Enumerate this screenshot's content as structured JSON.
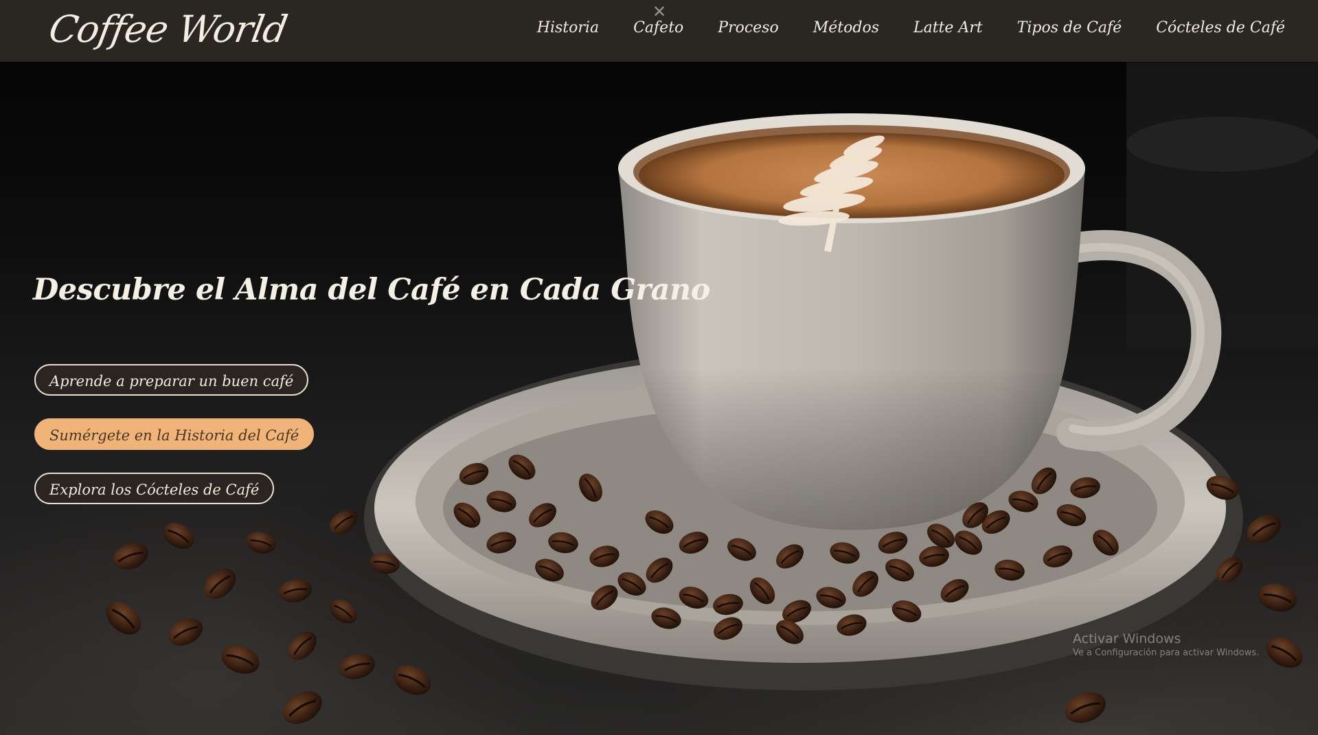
{
  "nav": {
    "logo": "Coffee World",
    "close_glyph": "✕",
    "links": [
      {
        "label": "Historia"
      },
      {
        "label": "Cafeto"
      },
      {
        "label": "Proceso"
      },
      {
        "label": "Métodos"
      },
      {
        "label": "Latte Art"
      },
      {
        "label": "Tipos de Café"
      },
      {
        "label": "Cócteles de Café"
      }
    ]
  },
  "hero": {
    "title": "Descubre el Alma del Café en Cada Grano",
    "buttons": [
      {
        "label": "Aprende a preparar un buen café"
      },
      {
        "label": "Sumérgete en la Historia del Café"
      },
      {
        "label": "Explora los Cócteles de Café"
      }
    ]
  },
  "watermark": {
    "title": "Activar Windows",
    "subtitle": "Ve a Configuración para activar Windows."
  },
  "colors": {
    "navbar_bg": "#2a2622",
    "accent_button": "#f0b479",
    "dark_button": "#2a2520",
    "text_light": "#f6efe4"
  }
}
